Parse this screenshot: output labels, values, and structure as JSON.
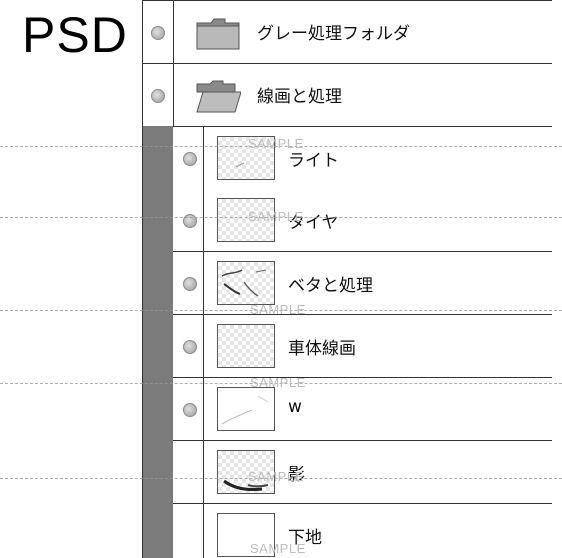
{
  "header": {
    "title": "PSD"
  },
  "groups": [
    {
      "label": "グレー処理フォルダ",
      "icon": "folder-closed-icon"
    },
    {
      "label": "線画と処理",
      "icon": "folder-open-icon"
    }
  ],
  "layers": [
    {
      "label": "ライト",
      "visible": true
    },
    {
      "label": "タイヤ",
      "visible": true
    },
    {
      "label": "ベタと処理",
      "visible": true
    },
    {
      "label": "車体線画",
      "visible": true
    },
    {
      "label": "w",
      "visible": true
    },
    {
      "label": "影",
      "visible": false
    },
    {
      "label": "下地",
      "visible": false
    }
  ],
  "watermark": {
    "text": "SAMPLE"
  },
  "colors": {
    "gutter": "#7b7b7b",
    "border": "#333333"
  }
}
